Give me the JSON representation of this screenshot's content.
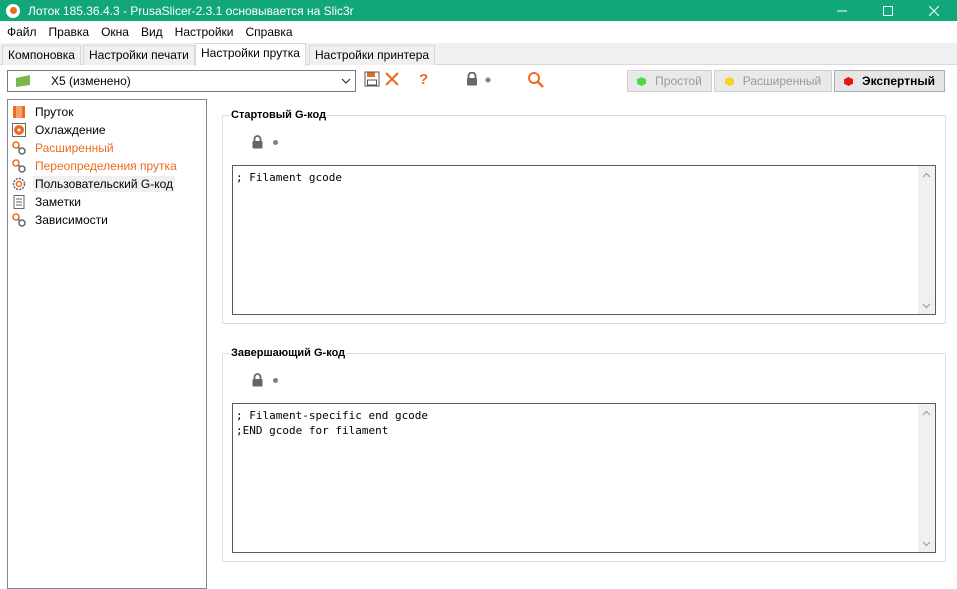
{
  "window": {
    "title": "Лоток 185.36.4.3 - PrusaSlicer-2.3.1 основывается на Slic3r"
  },
  "menu": {
    "items": [
      "Файл",
      "Правка",
      "Окна",
      "Вид",
      "Настройки",
      "Справка"
    ]
  },
  "tabs": [
    "Компоновка",
    "Настройки печати",
    "Настройки прутка",
    "Настройки принтера"
  ],
  "active_tab": "Настройки прутка",
  "preset": {
    "value": "X5 (изменено)",
    "flag_color": "#7ab648"
  },
  "modes": {
    "simple": {
      "label": "Простой",
      "color": "#4cd941"
    },
    "advanced": {
      "label": "Расширенный",
      "color": "#f7d21e"
    },
    "expert": {
      "label": "Экспертный",
      "color": "#e81616"
    }
  },
  "icons": {
    "save": "save-icon",
    "delete": "delete-x-icon",
    "question": "question-icon",
    "lock": "lock-icon",
    "search": "search-icon"
  },
  "colors": {
    "titlebar": "#12a67b",
    "accent_orange": "#ed6b21"
  },
  "tree": {
    "items": [
      {
        "label": "Пруток",
        "icon": "filament-icon",
        "style": "normal"
      },
      {
        "label": "Охлаждение",
        "icon": "cooling-fan-icon",
        "style": "normal"
      },
      {
        "label": "Расширенный",
        "icon": "advanced-wrench-icon",
        "style": "orange"
      },
      {
        "label": "Переопределения прутка",
        "icon": "overrides-wrench-icon",
        "style": "orange"
      },
      {
        "label": "Пользовательский G-код",
        "icon": "custom-gcode-gear-icon",
        "style": "selected"
      },
      {
        "label": "Заметки",
        "icon": "notes-icon",
        "style": "normal"
      },
      {
        "label": "Зависимости",
        "icon": "dependencies-wrench-icon",
        "style": "normal"
      }
    ]
  },
  "start_gcode": {
    "title": "Стартовый G-код",
    "lines": [
      "; Filament gcode"
    ]
  },
  "end_gcode": {
    "title": "Завершающий G-код",
    "lines": [
      "; Filament-specific end gcode",
      ";END gcode for filament"
    ]
  }
}
